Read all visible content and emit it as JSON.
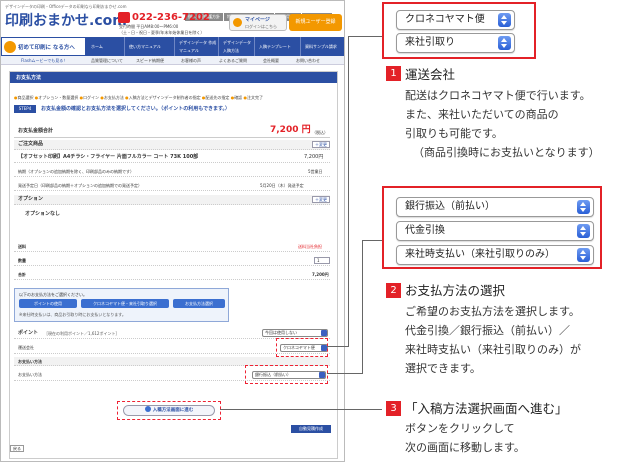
{
  "header": {
    "tagline": "デザインデータの印刷・Officeデータの印刷なら印刷おまかせ.com",
    "top_links": [
      "個人情報保護方針",
      "特定商取引に基づく表記",
      "ご利用規約",
      "サイトマップ"
    ],
    "logo_main": "印刷おまかせ.com",
    "phone": "022-236-7202",
    "hours": "受付時間 平日AM8:00～PM6:00",
    "hours_note": "（土・日・祝日・夏季/年末年始休業日を除く）",
    "mypage": "マイページ",
    "mypage_sub": "ログインはこちら",
    "register": "新規ユーザー登録"
  },
  "nav": {
    "beginner": "初めて印刷に なる方へ",
    "items": [
      "ホーム",
      "使い方マニュアル",
      "デザインデータ 作成マニュアル",
      "デザインデータ 入稿方法",
      "入稿テンプレート",
      "資料サンプル請求"
    ],
    "flash": "Flashムービーでも見る！",
    "sub_items": [
      "品質管理について",
      "スピード納期便",
      "お客様の声",
      "よくあるご質問",
      "会社概要",
      "お問い合わせ"
    ]
  },
  "form": {
    "section_title": "お支払方法",
    "steps": [
      "商品選択",
      "オプション・数量選択",
      "ログイン",
      "お支払方法",
      "入稿方法とデザインデータ制作者の指定",
      "配送先の指定",
      "確認",
      "注文完了"
    ],
    "step_badge": "STEP4",
    "step_desc": "お支払金額の確認とお支払方法を選択してください。（ポイントの利用もできます。）",
    "total_label": "お支払金額合計",
    "total_value": "7,200 円",
    "total_tax": "（税込）",
    "product_label": "ご注文商品",
    "change_label": "＋変更",
    "product_name": "【オフセット印刷】A4チラシ・フライヤー 片面フルカラー コート 73K 100部",
    "product_price": "7,200円",
    "lead_label": "納期（オプションの追加納期を除く、印刷部品のみの納期です）",
    "lead_value": "5営業日",
    "ship_label": "発送予定日（印刷部品の納期＋オプションの追加納期での発送予定）",
    "ship_value": "5月20日（木）発送予定",
    "option_label": "オプション",
    "option_value": "オプションなし",
    "shipping_fee_label": "送料",
    "shipping_fee_value": "送料当社負担",
    "qty_label": "数量",
    "qty_value": "1",
    "sum_label": "合計",
    "sum_value": "7,200円",
    "choose_label": "以下のお支払方法をご選択ください。",
    "btn_points": "ポイントの使用",
    "btn_kuroneko": "クロネコヤマト便・来社引取り選択",
    "btn_payment": "お支払方法選択",
    "note": "※来社時支払いは、商品お引取り時にお支払いとなります。",
    "points_label": "ポイント",
    "points_note": "［現在の利用ポイント／1,612ポイント］",
    "points_select": "今回は使用しない",
    "delivery_label": "運送会社",
    "delivery_select": "クロネコヤマト便",
    "pay_section": "お支払い方法",
    "pay_label": "お支払い方法",
    "pay_select": "銀行振込（前払い）",
    "next_button": "入稿方法画面に進む",
    "auto_button": "自動見積作成",
    "footer_tag": "戻る"
  },
  "callouts": {
    "shipping_options": [
      "クロネコヤマト便",
      "来社引取り"
    ],
    "c1_num": "1",
    "c1_title": "運送会社",
    "c1_body": [
      "配送はクロネコヤマト便で行います。",
      "また、来社いただいての商品の",
      "引取りも可能です。",
      "（商品引換時にお支払いとなります）"
    ],
    "payment_options": [
      "銀行振込（前払い）",
      "代金引換",
      "来社時支払い（来社引取りのみ）"
    ],
    "c2_num": "2",
    "c2_title": "お支払方法の選択",
    "c2_body": [
      "ご希望のお支払方法を選択します。",
      "代金引換／銀行振込（前払い）／",
      "来社時支払い（来社引取りのみ）が",
      "選択できます。"
    ],
    "c3_num": "3",
    "c3_title": "「入稿方法選択画面へ進む」",
    "c3_body": [
      "ボタンをクリックして",
      "次の画面に移動します。"
    ]
  },
  "colors": {
    "accent_red": "#e32127",
    "nav_blue": "#2b4fa3",
    "orange": "#f39800"
  }
}
